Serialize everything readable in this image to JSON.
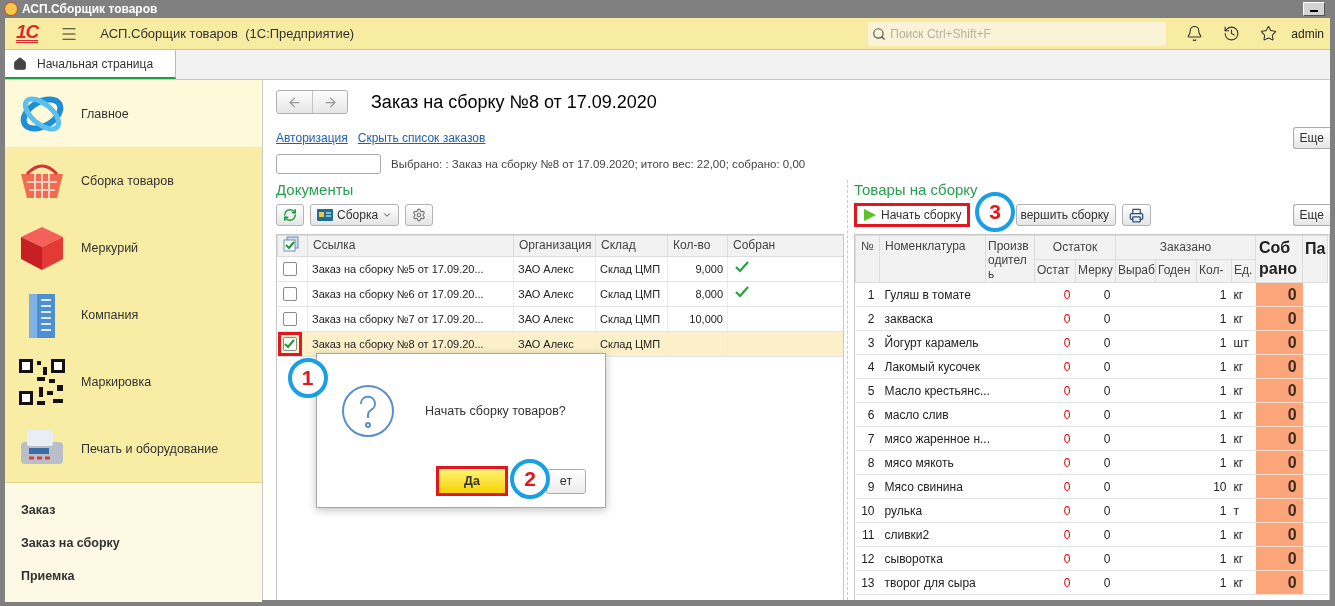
{
  "window": {
    "title": "АСП.Сборщик товаров"
  },
  "header": {
    "logo": "1С",
    "app_title": "АСП.Сборщик товаров  (1С:Предприятие)",
    "search": {
      "placeholder": "Поиск Ctrl+Shift+F"
    },
    "user": "admin"
  },
  "tabs": [
    {
      "label": "Начальная страница",
      "selected": true
    }
  ],
  "sidebar": {
    "sections": [
      {
        "label": "Главное",
        "kind": "main",
        "selected": true
      },
      {
        "label": "Сборка товаров",
        "kind": "basket",
        "selected": false
      },
      {
        "label": "Меркурий",
        "kind": "cube",
        "selected": false
      },
      {
        "label": "Компания",
        "kind": "building",
        "selected": false
      },
      {
        "label": "Маркировка",
        "kind": "qr",
        "selected": false
      },
      {
        "label": "Печать и оборудование",
        "kind": "terminal",
        "selected": false
      }
    ],
    "links": [
      "Заказ",
      "Заказ на сборку",
      "Приемка"
    ]
  },
  "form": {
    "title": "Заказ на сборку №8 от 17.09.2020",
    "links": [
      "Авторизация",
      "Скрыть список заказов"
    ],
    "more_button": "Еще",
    "summary": "Выбрано: : Заказ на сборку №8 от 17.09.2020; итого вес: 22,00; собрано: 0,00",
    "documents": {
      "title": "Документы",
      "toolbar": {
        "dropdown": "Сборка"
      },
      "columns": [
        "Ссылка",
        "Организация",
        "Склад",
        "Кол-во",
        "Собран"
      ],
      "rows": [
        {
          "checked": false,
          "selected": false,
          "highlighted": false,
          "link": "Заказ на сборку №5 от 17.09.20...",
          "organization": "ЗАО Алекс",
          "warehouse": "Склад ЦМП",
          "quantity": "9,000",
          "assembled": true
        },
        {
          "checked": false,
          "selected": false,
          "highlighted": false,
          "link": "Заказ на сборку №6 от 17.09.20...",
          "organization": "ЗАО Алекс",
          "warehouse": "Склад ЦМП",
          "quantity": "8,000",
          "assembled": true
        },
        {
          "checked": false,
          "selected": false,
          "highlighted": false,
          "link": "Заказ на сборку №7 от 17.09.20...",
          "organization": "ЗАО Алекс",
          "warehouse": "Склад ЦМП",
          "quantity": "10,000",
          "assembled": false
        },
        {
          "checked": true,
          "selected": true,
          "highlighted": true,
          "callout": "1",
          "link": "Заказ на сборку №8 от 17.09.20...",
          "organization": "ЗАО Алекс",
          "warehouse": "Склад ЦМП",
          "assembled": false
        }
      ]
    },
    "goods": {
      "title": "Товары на сборку",
      "toolbar": [
        {
          "kind": "play",
          "label": "Начать сборку",
          "highlighted": true,
          "callout": "3"
        },
        {
          "kind": "plain",
          "label": "вершить сборку",
          "highlighted": false
        },
        {
          "kind": "print",
          "highlighted": false
        }
      ],
      "more_button": "Еще",
      "columns": {
        "number": "№",
        "name": "Номенклатура",
        "producer": "Произв одитель",
        "stock_group": "Остаток",
        "stock": "Остат",
        "mercury": "Мерку",
        "ordered_group": "Заказано",
        "made": "Выраб",
        "expiry": "Годен",
        "quantity": "Кол-",
        "unit": "Ед.",
        "collected": "Соб рано",
        "column_11": "Па"
      },
      "rows": [
        {
          "number": "1",
          "name": "Гуляш в томате",
          "stock": "0",
          "mercury": "0",
          "quantity": "1",
          "unit": "кг",
          "collected": "0"
        },
        {
          "number": "2",
          "name": "закваска",
          "stock": "0",
          "mercury": "0",
          "quantity": "1",
          "unit": "кг",
          "collected": "0"
        },
        {
          "number": "3",
          "name": "Йогурт карамель",
          "stock": "0",
          "mercury": "0",
          "quantity": "1",
          "unit": "шт",
          "collected": "0"
        },
        {
          "number": "4",
          "name": "Лакомый кусочек",
          "stock": "0",
          "mercury": "0",
          "quantity": "1",
          "unit": "кг",
          "collected": "0"
        },
        {
          "number": "5",
          "name": "Масло крестьянс...",
          "stock": "0",
          "mercury": "0",
          "quantity": "1",
          "unit": "кг",
          "collected": "0"
        },
        {
          "number": "6",
          "name": "масло слив",
          "stock": "0",
          "mercury": "0",
          "quantity": "1",
          "unit": "кг",
          "collected": "0"
        },
        {
          "number": "7",
          "name": "мясо жаренное н...",
          "stock": "0",
          "mercury": "0",
          "quantity": "1",
          "unit": "кг",
          "collected": "0"
        },
        {
          "number": "8",
          "name": "мясо мякоть",
          "stock": "0",
          "mercury": "0",
          "quantity": "1",
          "unit": "кг",
          "collected": "0"
        },
        {
          "number": "9",
          "name": "Мясо свинина",
          "stock": "0",
          "mercury": "0",
          "quantity": "10",
          "unit": "кг",
          "collected": "0"
        },
        {
          "number": "10",
          "name": "рулька",
          "stock": "0",
          "mercury": "0",
          "quantity": "1",
          "unit": "т",
          "collected": "0"
        },
        {
          "number": "11",
          "name": "сливки2",
          "stock": "0",
          "mercury": "0",
          "quantity": "1",
          "unit": "кг",
          "collected": "0"
        },
        {
          "number": "12",
          "name": "сыворотка",
          "stock": "0",
          "mercury": "0",
          "quantity": "1",
          "unit": "кг",
          "collected": "0"
        },
        {
          "number": "13",
          "name": "творог для сыра",
          "stock": "0",
          "mercury": "0",
          "quantity": "1",
          "unit": "кг",
          "collected": "0"
        }
      ]
    }
  },
  "dialog": {
    "message": "Начать сборку товаров?",
    "buttons": [
      {
        "label": "Да",
        "highlighted": true,
        "callout": "2"
      },
      {
        "label": "ет",
        "highlighted": false
      }
    ]
  }
}
